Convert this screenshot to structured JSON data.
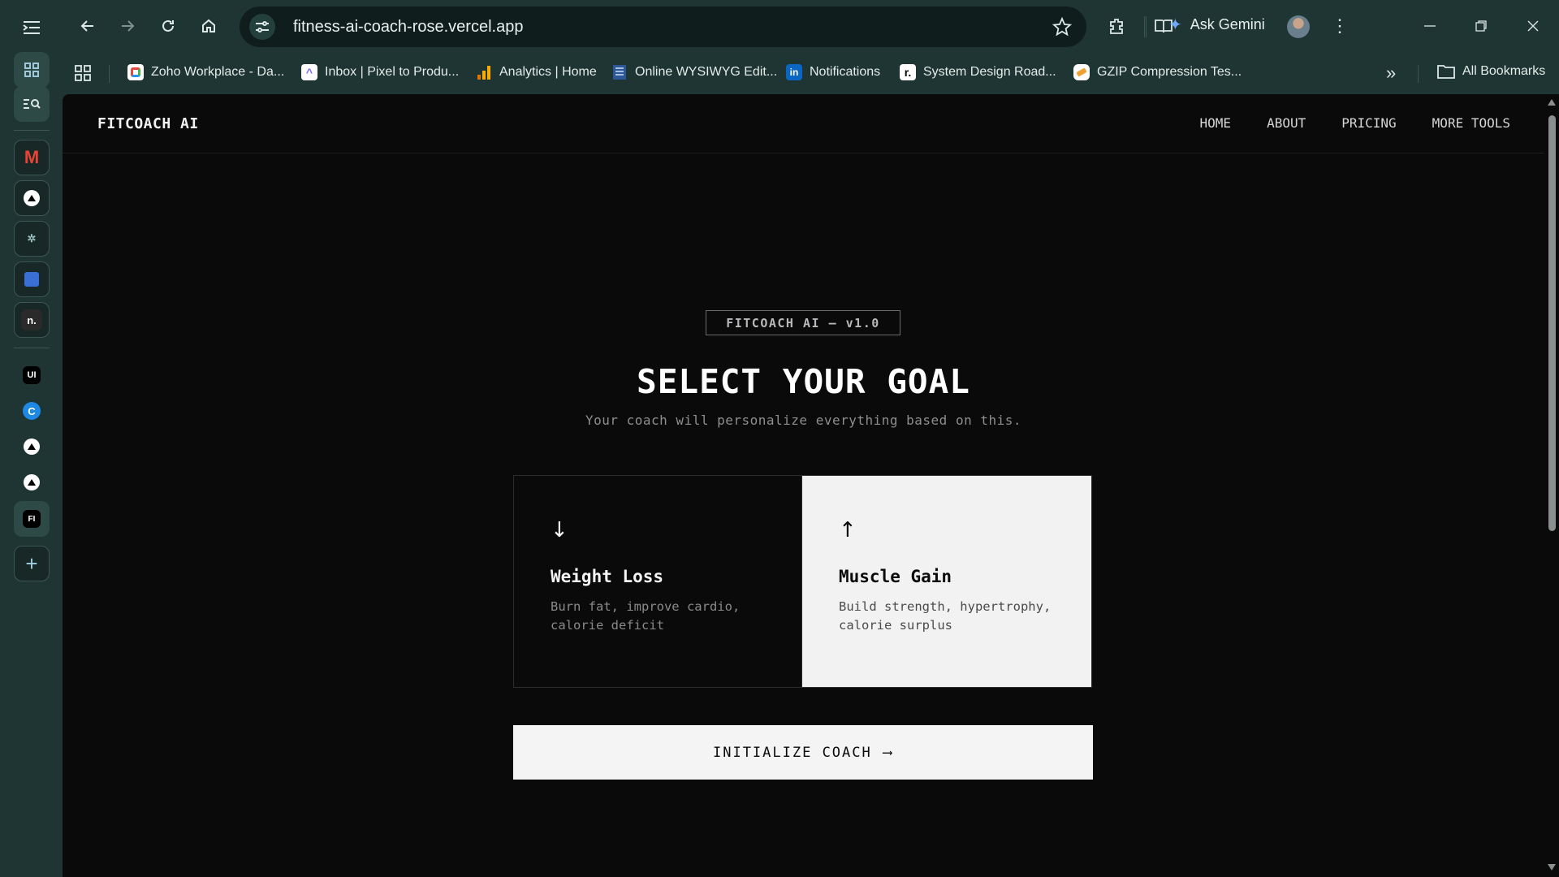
{
  "browser": {
    "url": "fitness-ai-coach-rose.vercel.app",
    "ask_gemini": "Ask Gemini",
    "all_bookmarks": "All Bookmarks",
    "bookmarks": [
      {
        "label": "Zoho Workplace - Da...",
        "icon": "zoho-icon",
        "color": "#e8453c"
      },
      {
        "label": "Inbox | Pixel to Produ...",
        "icon": "clickup-icon",
        "color": "#7b68ee"
      },
      {
        "label": "Analytics | Home",
        "icon": "analytics-icon",
        "color": "#f9ab00"
      },
      {
        "label": "Online WYSIWYG Edit...",
        "icon": "document-icon",
        "color": "#9fb7d8"
      },
      {
        "label": "Notifications",
        "icon": "linkedin-icon",
        "color": "#0a66c2"
      },
      {
        "label": "System Design Road...",
        "icon": "roadmap-icon",
        "color": "#ffffff"
      },
      {
        "label": "GZIP Compression Tes...",
        "icon": "gzip-icon",
        "color": "#f0a030"
      }
    ],
    "side_letters": {
      "ui": "UI",
      "fi": "FI",
      "n": "n."
    }
  },
  "site": {
    "logo": "FITCOACH AI",
    "nav": [
      "HOME",
      "ABOUT",
      "PRICING",
      "MORE TOOLS"
    ],
    "badge": "FITCOACH AI — v1.0",
    "title": "SELECT YOUR GOAL",
    "subtitle": "Your coach will personalize everything based on this.",
    "goals": [
      {
        "arrow": "↓",
        "title": "Weight Loss",
        "desc": "Burn fat, improve cardio, calorie deficit",
        "selected": false
      },
      {
        "arrow": "↑",
        "title": "Muscle Gain",
        "desc": "Build strength, hypertrophy, calorie surplus",
        "selected": true
      }
    ],
    "cta": "INITIALIZE COACH",
    "cta_arrow": "⟶"
  }
}
